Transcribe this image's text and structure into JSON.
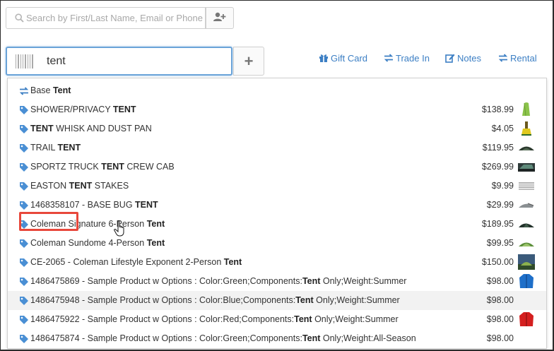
{
  "customer_search": {
    "placeholder": "Search by First/Last Name, Email or Phone",
    "icon": "search-icon",
    "add_icon": "add-user-icon"
  },
  "product_search": {
    "value": "tent",
    "icon": "barcode-icon",
    "add_label": "+"
  },
  "toolbar": {
    "gift_card": "Gift Card",
    "trade_in": "Trade In",
    "notes": "Notes",
    "rental": "Rental"
  },
  "colors": {
    "link": "#3c7fc4",
    "tag": "#4a8fd4",
    "highlight": "#e8473b",
    "focus_border": "#6aa3d8"
  },
  "results": [
    {
      "icon": "swap-icon",
      "pre": "Base ",
      "bold": "Tent",
      "post": "",
      "price": "",
      "thumb": ""
    },
    {
      "icon": "tag-icon",
      "pre": "SHOWER/PRIVACY ",
      "bold": "TENT",
      "post": "",
      "price": "$138.99",
      "thumb": "green-shelter"
    },
    {
      "icon": "tag-icon",
      "pre": "",
      "bold": "TENT",
      "post": " WHISK AND DUST PAN",
      "price": "$4.05",
      "thumb": "whisk-broom"
    },
    {
      "icon": "tag-icon",
      "pre": "TRAIL ",
      "bold": "TENT",
      "post": "",
      "price": "$119.95",
      "thumb": "dome-tent"
    },
    {
      "icon": "tag-icon",
      "pre": "SPORTZ TRUCK ",
      "bold": "TENT",
      "post": " CREW CAB",
      "price": "$269.99",
      "thumb": "truck-tent"
    },
    {
      "icon": "tag-icon",
      "pre": "EASTON ",
      "bold": "TENT",
      "post": " STAKES",
      "price": "$9.99",
      "thumb": "stakes"
    },
    {
      "icon": "tag-icon",
      "pre": "1468358107 - BASE BUG ",
      "bold": "TENT",
      "post": "",
      "price": "$29.99",
      "thumb": "bug-tent"
    },
    {
      "icon": "tag-icon",
      "pre": "Coleman Signature 6-Person ",
      "bold": "Tent",
      "post": "",
      "price": "$189.95",
      "thumb": "dark-tent"
    },
    {
      "icon": "tag-icon",
      "pre": "Coleman Sundome 4-Person ",
      "bold": "Tent",
      "post": "",
      "price": "$99.95",
      "thumb": "green-dome"
    },
    {
      "icon": "tag-icon",
      "pre": "CE-2065 - Coleman Lifestyle Exponent 2-Person ",
      "bold": "Tent",
      "post": "",
      "price": "$150.00",
      "thumb": "tent-scene"
    },
    {
      "icon": "tag-icon",
      "pre": "1486475869 - Sample Product w Options : Color:Green;Components:",
      "bold": "Tent",
      "post": " Only;Weight:Summer",
      "price": "$98.00",
      "thumb": "blue-jacket"
    },
    {
      "icon": "tag-icon",
      "pre": "1486475948 - Sample Product w Options : Color:Blue;Components:",
      "bold": "Tent",
      "post": " Only;Weight:Summer",
      "price": "$98.00",
      "thumb": ""
    },
    {
      "icon": "tag-icon",
      "pre": "1486475922 - Sample Product w Options : Color:Red;Components:",
      "bold": "Tent",
      "post": " Only;Weight:Summer",
      "price": "$98.00",
      "thumb": "red-jacket"
    },
    {
      "icon": "tag-icon",
      "pre": "1486475874 - Sample Product w Options : Color:Green;Components:",
      "bold": "Tent",
      "post": " Only;Weight:All-Season",
      "price": "$98.00",
      "thumb": ""
    }
  ]
}
